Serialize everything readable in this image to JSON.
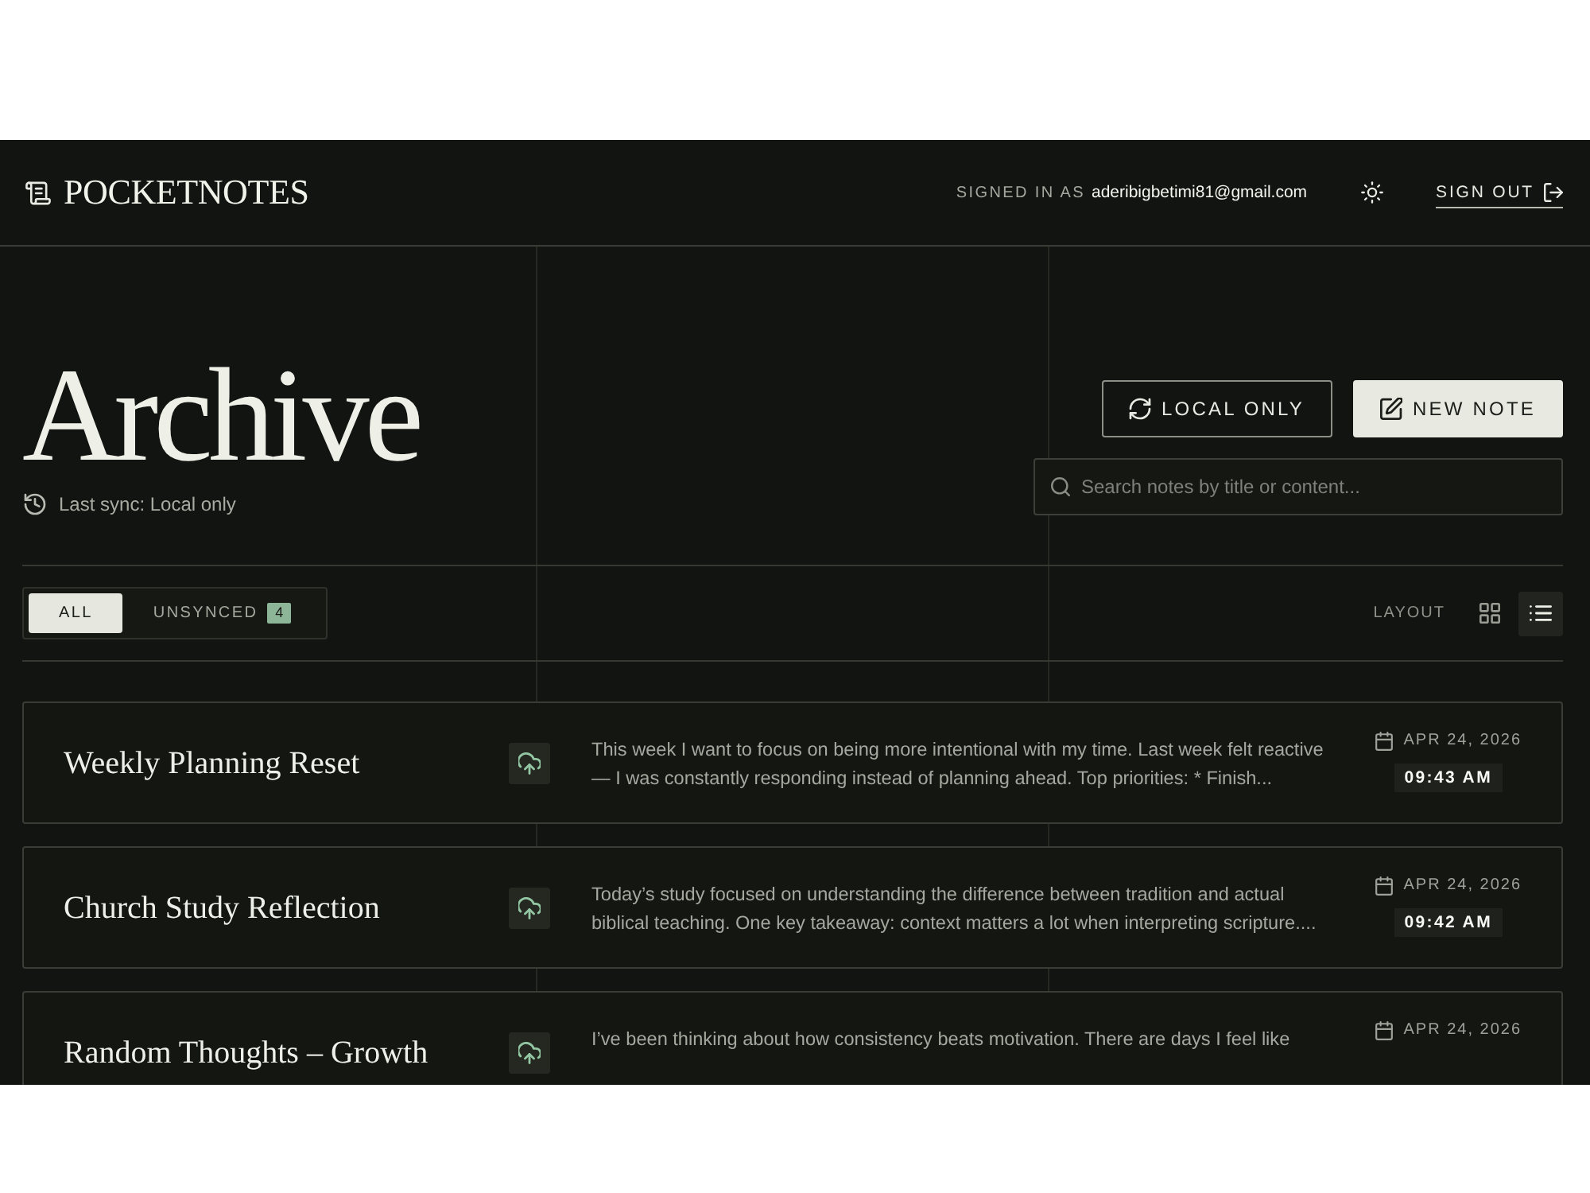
{
  "header": {
    "logo": "POCKETNOTES",
    "signed_in_label": "SIGNED IN AS",
    "email": "aderibigbetimi81@gmail.com",
    "sign_out": "SIGN OUT"
  },
  "page": {
    "title": "Archive",
    "last_sync": "Last sync: Local only"
  },
  "actions": [
    {
      "kind": "outline",
      "label": "LOCAL ONLY"
    },
    {
      "kind": "primary",
      "label": "NEW NOTE"
    }
  ],
  "search": {
    "placeholder": "Search notes by title or content..."
  },
  "filters": [
    {
      "label": "ALL",
      "selected": true
    },
    {
      "label": "UNSYNCED",
      "selected": false,
      "count": "4"
    }
  ],
  "layout": {
    "label": "LAYOUT",
    "options": [
      {
        "kind": "grid",
        "selected": false
      },
      {
        "kind": "list",
        "selected": true
      }
    ]
  },
  "notes": [
    {
      "title": "Weekly Planning Reset",
      "unsynced": true,
      "excerpt": "This week I want to focus on being more intentional with my time. Last week felt reactive — I was constantly responding instead of planning ahead. Top priorities: * Finish...",
      "date": "APR 24, 2026",
      "time": "09:43 AM"
    },
    {
      "title": "Church Study Reflection",
      "unsynced": true,
      "excerpt": "Today’s study focused on understanding the difference between tradition and actual biblical teaching. One key takeaway: context matters a lot when interpreting scripture....",
      "date": "APR 24, 2026",
      "time": "09:42 AM"
    },
    {
      "title": "Random Thoughts – Growth",
      "unsynced": true,
      "excerpt": "I’ve been thinking about how consistency beats motivation. There are days I feel like",
      "date": "APR 24, 2026"
    }
  ]
}
